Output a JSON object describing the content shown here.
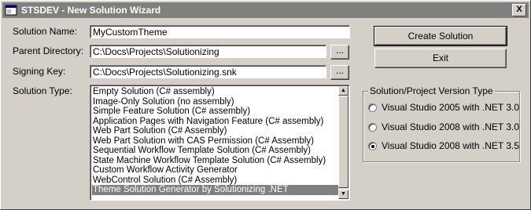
{
  "window": {
    "title": "STSDEV - New Solution Wizard",
    "close_label": "X"
  },
  "form": {
    "solution_name": {
      "label": "Solution Name:",
      "value": "MyCustomTheme"
    },
    "parent_directory": {
      "label": "Parent Directory:",
      "value": "C:\\Docs\\Projects\\Solutionizing",
      "browse_label": "..."
    },
    "signing_key": {
      "label": "Signing Key:",
      "value": "C:\\Docs\\Projects\\Solutionizing.snk",
      "browse_label": "..."
    },
    "solution_type": {
      "label": "Solution Type:",
      "items": [
        "Empty Solution (C# assembly)",
        "Image-Only Solution (no assembly)",
        "Simple Feature Solution (C# assembly)",
        "Application Pages with Navigation Feature (C# assembly)",
        "Web Part Solution (C# Assembly)",
        "Web Part Solution with CAS Permission (C# Assembly)",
        "Sequential Workflow Template Solution (C# Assembly)",
        "State Machine Workflow Template Solution (C# Assembly)",
        "Custom Workflow Activity Generator",
        "WebControl Solution (C# Assembly)",
        "Theme Solution Generator by Solutionizing .NET"
      ],
      "selected_index": 10
    }
  },
  "buttons": {
    "create_label": "Create Solution",
    "exit_label": "Exit"
  },
  "version_group": {
    "title": "Solution/Project Version Type",
    "options": [
      {
        "label": "Visual Studio 2005 with .NET 3.0",
        "checked": false
      },
      {
        "label": "Visual Studio 2008 with .NET 3.0",
        "checked": false
      },
      {
        "label": "Visual Studio 2008 with .NET 3.5",
        "checked": true
      }
    ]
  },
  "colors": {
    "face": "#d4d0c8",
    "titlebar": "#808080",
    "selection": "#808080"
  }
}
